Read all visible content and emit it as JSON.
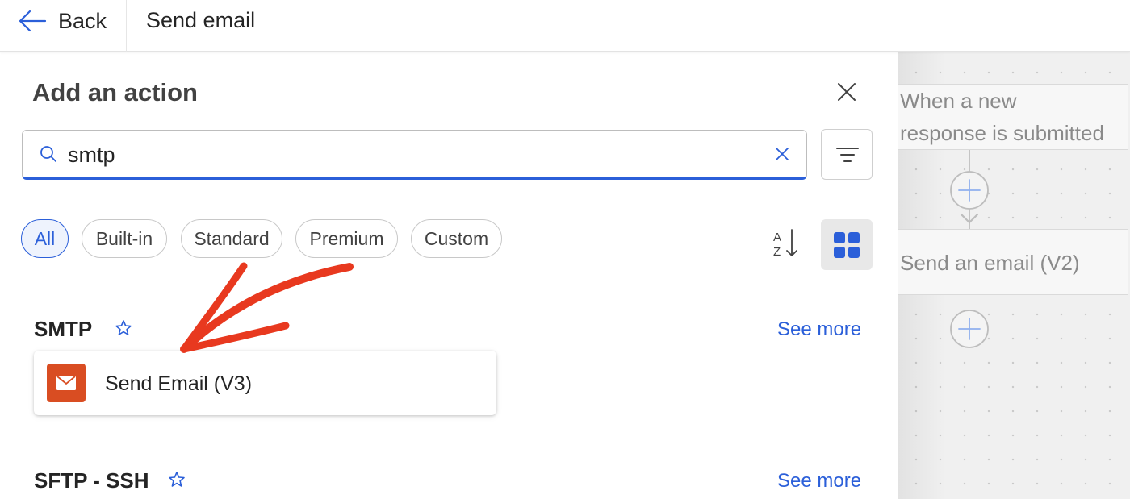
{
  "header": {
    "back_label": "Back",
    "title": "Send email"
  },
  "panel": {
    "title": "Add an action",
    "search": {
      "value": "smtp",
      "placeholder": ""
    },
    "filters": [
      {
        "label": "All",
        "active": true
      },
      {
        "label": "Built-in",
        "active": false
      },
      {
        "label": "Standard",
        "active": false
      },
      {
        "label": "Premium",
        "active": false
      },
      {
        "label": "Custom",
        "active": false
      }
    ],
    "sections": [
      {
        "title": "SMTP",
        "see_more": "See more",
        "actions": [
          {
            "label": "Send Email (V3)",
            "icon": "mail-icon"
          }
        ]
      },
      {
        "title": "SFTP - SSH",
        "see_more": "See more",
        "actions": []
      }
    ]
  },
  "flow": {
    "trigger": "When a new response is submitted",
    "trigger_lines": [
      "When a new",
      "response is submitted"
    ],
    "action": "Send an email (V2)"
  },
  "colors": {
    "accent": "#2b5fd9",
    "smtp_logo": "#d94d22",
    "annotation_arrow": "#e8391f"
  }
}
